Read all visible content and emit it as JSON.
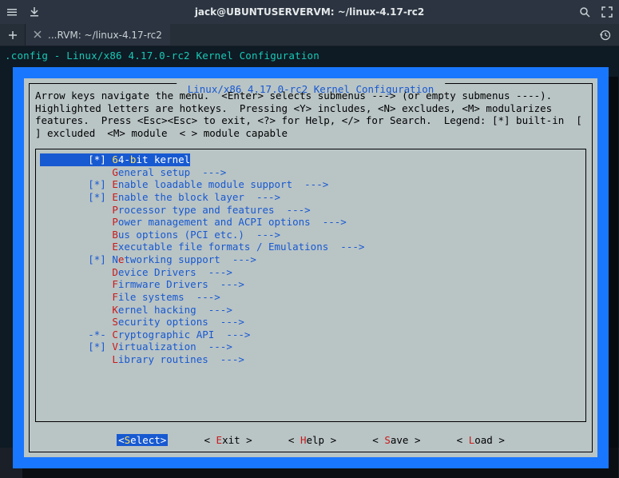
{
  "window": {
    "title": "jack@UBUNTUSERVERVM: ~/linux-4.17-rc2",
    "tab_label": "...RVM: ~/linux-4.17-rc2"
  },
  "config_line": ".config - Linux/x86 4.17.0-rc2 Kernel Configuration",
  "dialog_title": " Linux/x86 4.17.0-rc2 Kernel Configuration ",
  "help_text": "Arrow keys navigate the menu.  <Enter> selects submenus ---> (or empty submenus ----).  Highlighted letters are hotkeys.  Pressing <Y> includes, <N> excludes, <M> modularizes features.  Press <Esc><Esc> to exit, <?> for Help, </> for Search.  Legend: [*] built-in  [ ] excluded  <M> module  < > module capable",
  "menu": [
    {
      "prefix": "[*] ",
      "hot": "6",
      "rest": "4-",
      "hot2": "b",
      "rest2": "it kernel",
      "selected": true
    },
    {
      "prefix": "    ",
      "hot": "G",
      "rest": "eneral setup  --->"
    },
    {
      "prefix": "[*] ",
      "hot": "E",
      "rest": "nable loadable module support  --->"
    },
    {
      "prefix": "[*] ",
      "hot": "E",
      "rest": "nable the block layer  --->"
    },
    {
      "prefix": "    ",
      "hot": "P",
      "rest": "rocessor type and features  --->"
    },
    {
      "prefix": "    ",
      "hot": "P",
      "rest": "ower management and ACPI options  --->"
    },
    {
      "prefix": "    ",
      "hot": "B",
      "rest": "us options (PCI etc.)  --->"
    },
    {
      "prefix": "    ",
      "hot": "E",
      "rest": "xecutable file formats / Emulations  --->"
    },
    {
      "prefix": "[*] N",
      "hot": "e",
      "rest": "tworking support  --->"
    },
    {
      "prefix": "    ",
      "hot": "D",
      "rest": "evice Drivers  --->"
    },
    {
      "prefix": "    ",
      "hot": "F",
      "rest": "irmware Drivers  --->"
    },
    {
      "prefix": "    ",
      "hot": "F",
      "rest": "ile systems  --->"
    },
    {
      "prefix": "    ",
      "hot": "K",
      "rest": "ernel hacking  --->"
    },
    {
      "prefix": "    ",
      "hot": "S",
      "rest": "ecurity options  --->"
    },
    {
      "prefix": "-*- ",
      "hot": "C",
      "rest": "ryptographic API  --->"
    },
    {
      "prefix": "[*] ",
      "hot": "V",
      "rest": "irtualization  --->"
    },
    {
      "prefix": "    ",
      "hot": "L",
      "rest": "ibrary routines  --->"
    }
  ],
  "buttons": [
    {
      "pre": "<",
      "hot": "S",
      "post": "elect>",
      "selected": true
    },
    {
      "pre": "< ",
      "hot": "E",
      "post": "xit >"
    },
    {
      "pre": "< ",
      "hot": "H",
      "post": "elp >"
    },
    {
      "pre": "< ",
      "hot": "S",
      "post": "ave >"
    },
    {
      "pre": "< ",
      "hot": "L",
      "post": "oad >"
    }
  ]
}
